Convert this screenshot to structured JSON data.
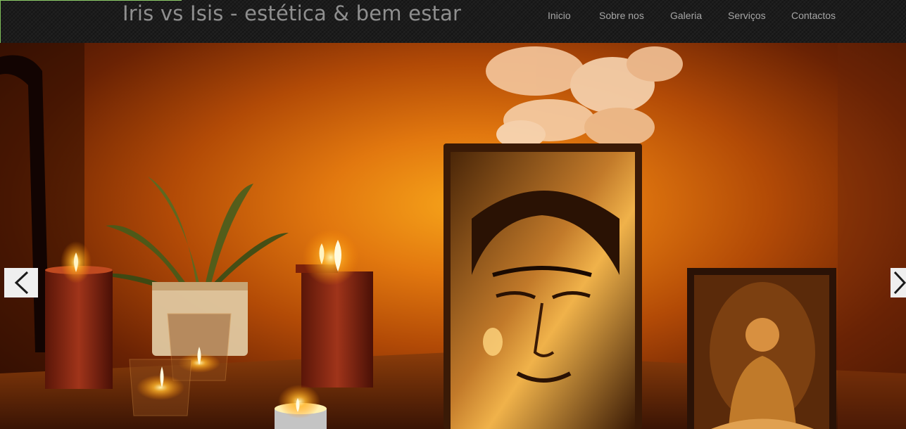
{
  "header": {
    "site_title": "Iris vs Isis - estética & bem estar"
  },
  "nav": {
    "items": [
      {
        "label": "Inicio"
      },
      {
        "label": "Sobre nos"
      },
      {
        "label": "Galeria"
      },
      {
        "label": "Serviços"
      },
      {
        "label": "Contactos"
      }
    ]
  },
  "slider": {
    "prev_icon": "chevron-left-icon",
    "next_icon": "chevron-right-icon",
    "image_description_icon": "buddha-candles-photo"
  },
  "colors": {
    "header_bg": "#1c1c1c",
    "title_text": "#8f8f8f",
    "nav_text": "#a6a6a6",
    "accent": "#8fcf6a",
    "arrow_bg": "#efefef"
  }
}
